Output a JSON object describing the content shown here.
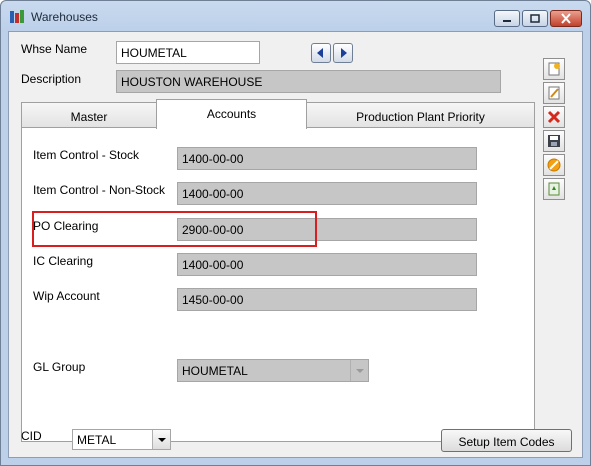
{
  "window": {
    "title": "Warehouses"
  },
  "header": {
    "whse_name_label": "Whse Name",
    "whse_name_value": "HOUMETAL",
    "description_label": "Description",
    "description_value": "HOUSTON WAREHOUSE"
  },
  "tabs": [
    {
      "label": "Master",
      "active": false
    },
    {
      "label": "Accounts",
      "active": true
    },
    {
      "label": "Production Plant Priority",
      "active": false
    }
  ],
  "accounts": {
    "item_control_stock_label": "Item Control - Stock",
    "item_control_stock_value": "1400-00-00",
    "item_control_nonstock_label": "Item Control - Non-Stock",
    "item_control_nonstock_value": "1400-00-00",
    "po_clearing_label": "PO Clearing",
    "po_clearing_value": "2900-00-00",
    "ic_clearing_label": "IC Clearing",
    "ic_clearing_value": "1400-00-00",
    "wip_account_label": "Wip Account",
    "wip_account_value": "1450-00-00",
    "gl_group_label": "GL Group",
    "gl_group_value": "HOUMETAL"
  },
  "footer": {
    "cid_label": "CID",
    "cid_value": "METAL",
    "setup_item_codes_label": "Setup Item Codes"
  },
  "toolbar_icons": [
    "new-record-icon",
    "edit-record-icon",
    "delete-icon",
    "save-icon",
    "cancel-icon",
    "refresh-icon"
  ],
  "colors": {
    "highlight": "#d81e1e",
    "readonly_field": "#c6c6c6"
  }
}
